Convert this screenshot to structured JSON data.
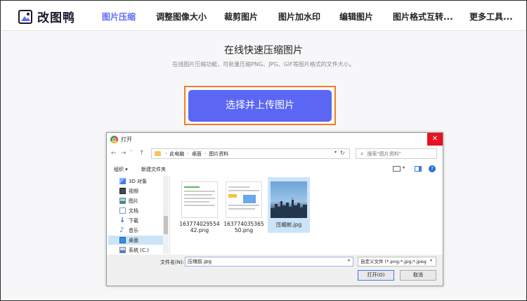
{
  "brand": {
    "name": "改图鸭"
  },
  "nav": {
    "items": [
      {
        "label": "图片压缩",
        "active": true
      },
      {
        "label": "调整图像大小"
      },
      {
        "label": "裁剪图片"
      },
      {
        "label": "图片加水印"
      },
      {
        "label": "编辑图片"
      },
      {
        "label": "图片格式互转..."
      },
      {
        "label": "更多工具..."
      }
    ]
  },
  "hero": {
    "title": "在线快速压缩图片",
    "subtitle": "在线图片压缩功能，可批量压缩PNG、JPG、GIF等图片格式的文件大小。",
    "upload_label": "选择并上传图片"
  },
  "colors": {
    "accent": "#5b66f3",
    "highlight_outline": "#f07f25",
    "close": "#e81123"
  },
  "dialog": {
    "title": "打开",
    "close_glyph": "✕",
    "nav": {
      "back": "←",
      "forward": "→",
      "history": "˅",
      "up": "↑"
    },
    "breadcrumb": [
      "此电脑",
      "桌面",
      "图片资料"
    ],
    "breadcrumb_sep": "›",
    "search_placeholder": "搜索\"图片资料\"",
    "toolbar": {
      "organize": "组织 ▾",
      "new_folder": "新建文件夹",
      "help": "?"
    },
    "sidebar": [
      {
        "label": "3D 对象",
        "icon": "3d-objects-icon"
      },
      {
        "label": "视频",
        "icon": "video-icon"
      },
      {
        "label": "图片",
        "icon": "pictures-icon"
      },
      {
        "label": "文档",
        "icon": "documents-icon"
      },
      {
        "label": "下载",
        "icon": "download-icon"
      },
      {
        "label": "音乐",
        "icon": "music-icon"
      },
      {
        "label": "桌面",
        "icon": "desktop-icon",
        "selected": true
      },
      {
        "label": "系统 (C:)",
        "icon": "drive-icon"
      }
    ],
    "files": [
      {
        "name": "16377402955442.png",
        "kind": "screenshot"
      },
      {
        "name": "16377403536550.png",
        "kind": "screenshot"
      },
      {
        "name": "压缩前.jpg",
        "kind": "photo",
        "selected": true
      }
    ],
    "filename_label": "文件名(N):",
    "filename_value": "压缩前.jpg",
    "filetype_value": "自定义文件 (*.png;*.jpg;*.jpeg",
    "open_label": "打开(O)",
    "cancel_label": "取消"
  }
}
